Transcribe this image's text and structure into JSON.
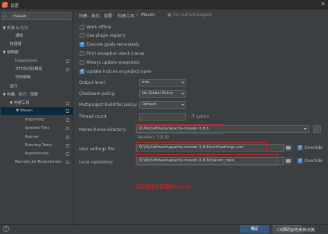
{
  "window": {
    "title": "设置"
  },
  "search": {
    "value": "maven"
  },
  "tree": [
    {
      "label": "▼ 外观 & 行为"
    },
    {
      "label": "通知"
    },
    {
      "label": "快捷键"
    },
    {
      "label": "▼ 编辑器"
    },
    {
      "label": "Inspections"
    },
    {
      "label": "文件和代码模板"
    },
    {
      "label": "代码模板"
    },
    {
      "label": "插件"
    },
    {
      "label": "▼ 构建、执行、部署"
    },
    {
      "label": "▼ 构建工具"
    },
    {
      "label": "▼ Maven"
    },
    {
      "label": "Importing"
    },
    {
      "label": "Ignored Files"
    },
    {
      "label": "Runner"
    },
    {
      "label": "Running Tests"
    },
    {
      "label": "Repositories"
    },
    {
      "label": "Remote Jar Repositories"
    }
  ],
  "breadcrumb": {
    "p1": "构建、执行、部署",
    "sep": "›",
    "p2": "构建工具",
    "p3": "Maven",
    "project": "For current project"
  },
  "options": [
    {
      "label": "Work offline",
      "checked": false
    },
    {
      "label": "Use plugin registry",
      "checked": false
    },
    {
      "label": "Execute goals recursively",
      "checked": true
    },
    {
      "label": "Print exception stack traces",
      "checked": false
    },
    {
      "label": "Always update snapshots",
      "checked": false
    },
    {
      "label": "Update indices on project open",
      "checked": true
    }
  ],
  "output_level": {
    "label": "Output level:",
    "value": "Info"
  },
  "checksum_policy": {
    "label": "Checksum policy:",
    "value": "No Global Policy"
  },
  "multiproject": {
    "label": "Multiproject build fail policy:",
    "value": "Default"
  },
  "thread_count": {
    "label": "Thread count",
    "value": "",
    "hint": "-T option"
  },
  "maven_home": {
    "label": "Maven home directory:",
    "value": "D:/MySoftware/apache-maven-3.8.8",
    "version": "(Version: 3.8.8)",
    "more": "..."
  },
  "user_settings": {
    "label": "User settings file:",
    "value": "D:\\MySoftware\\apache-maven-3.8.8\\conf\\settings.xml",
    "override": "Override"
  },
  "local_repo": {
    "label": "Local repository:",
    "value": "D:\\MySoftware\\apache-maven-3.8.8\\maven_repo",
    "override": "Override"
  },
  "annotation": "是否是刚才配置的maven",
  "buttons": {
    "ok": "确定",
    "cancel": "取消"
  },
  "watermark": "CSDN @明天依旧美",
  "help": "?",
  "colors": {
    "annotation": "#e02020",
    "accent": "#4a88c7",
    "selection": "#0d293e"
  }
}
